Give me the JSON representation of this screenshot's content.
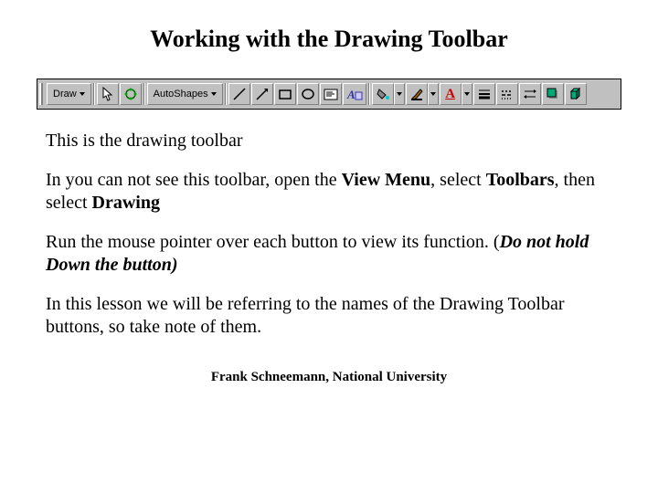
{
  "title": "Working with the Drawing Toolbar",
  "toolbar": {
    "draw_label": "Draw",
    "autoshapes_label": "AutoShapes",
    "buttons": {
      "select": "select-objects",
      "rotate": "free-rotate",
      "line": "line",
      "arrow": "arrow",
      "rect": "rectangle",
      "oval": "oval",
      "textbox": "text-box",
      "wordart": "insert-wordart",
      "fill": "fill-color",
      "linecolor": "line-color",
      "fontcolor": "font-color",
      "linestyle": "line-style",
      "dashstyle": "dash-style",
      "arrowstyle": "arrow-style",
      "shadow": "shadow",
      "threed": "3-d"
    }
  },
  "p1": "This is the drawing toolbar",
  "p2a": "In you can not see this toolbar, open the ",
  "p2b": "View Menu",
  "p2c": ", select ",
  "p2d": "Toolbars",
  "p2e": ", then select ",
  "p2f": "Drawing",
  "p3a": "Run the mouse pointer over each button to view its function. (",
  "p3b": "Do not hold Down the button)",
  "p4": "In this lesson we will be referring to the names of the Drawing Toolbar buttons, so take note of them.",
  "footer": "Frank Schneemann, National University"
}
